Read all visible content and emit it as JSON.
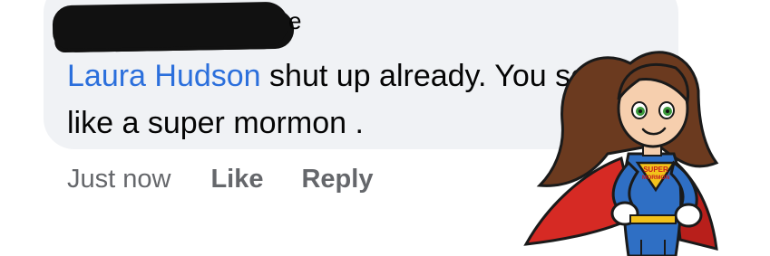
{
  "comment": {
    "author_visible_fragment": "e",
    "mention": "Laura Hudson",
    "body": " shut up already. You sound like a super mormon ."
  },
  "actions": {
    "timestamp": "Just now",
    "like_label": "Like",
    "reply_label": "Reply"
  },
  "sticker": {
    "badge_line1": "SUPER",
    "badge_line2": "MORMON",
    "icon": "superhero-girl-sticker"
  },
  "colors": {
    "bubble": "#f0f2f5",
    "mention": "#2b6fdc",
    "meta": "#65676b",
    "cape": "#d62a24",
    "suit": "#2f6fc4"
  }
}
